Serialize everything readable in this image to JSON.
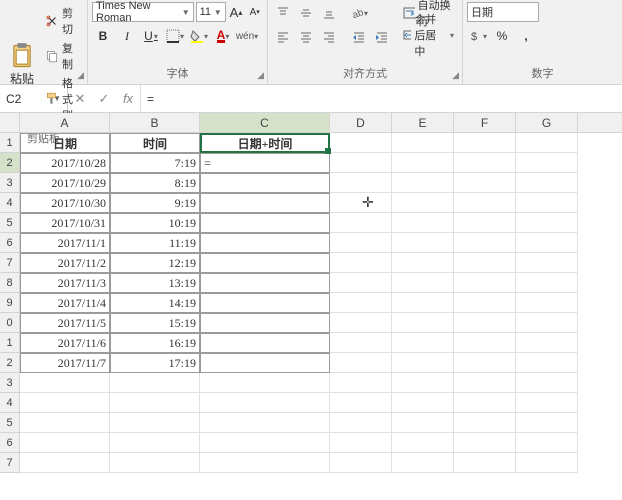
{
  "ribbon": {
    "clipboard": {
      "title": "剪贴板",
      "paste": "粘贴",
      "cut": "剪切",
      "copy": "复制",
      "format_painter": "格式刷"
    },
    "font": {
      "title": "字体",
      "name": "Times New Roman",
      "size": "11",
      "bold": "B",
      "italic": "I",
      "underline": "U"
    },
    "alignment": {
      "title": "对齐方式",
      "wrap": "自动换行",
      "merge": "合并后居中"
    },
    "number": {
      "title": "数字",
      "format": "日期",
      "percent": "%",
      "comma": ","
    }
  },
  "formula_bar": {
    "name_box": "C2",
    "formula": "="
  },
  "columns": [
    "A",
    "B",
    "C",
    "D",
    "E",
    "F",
    "G"
  ],
  "headers": {
    "A": "日期",
    "B": "时间",
    "C": "日期+时间"
  },
  "data_rows": [
    {
      "n": "2",
      "A": "2017/10/28",
      "B": "7:19",
      "C": "="
    },
    {
      "n": "3",
      "A": "2017/10/29",
      "B": "8:19",
      "C": ""
    },
    {
      "n": "4",
      "A": "2017/10/30",
      "B": "9:19",
      "C": ""
    },
    {
      "n": "5",
      "A": "2017/10/31",
      "B": "10:19",
      "C": ""
    },
    {
      "n": "6",
      "A": "2017/11/1",
      "B": "11:19",
      "C": ""
    },
    {
      "n": "7",
      "A": "2017/11/2",
      "B": "12:19",
      "C": ""
    },
    {
      "n": "8",
      "A": "2017/11/3",
      "B": "13:19",
      "C": ""
    },
    {
      "n": "9",
      "A": "2017/11/4",
      "B": "14:19",
      "C": ""
    },
    {
      "n": "0",
      "A": "2017/11/5",
      "B": "15:19",
      "C": ""
    },
    {
      "n": "1",
      "A": "2017/11/6",
      "B": "16:19",
      "C": ""
    },
    {
      "n": "2",
      "A": "2017/11/7",
      "B": "17:19",
      "C": ""
    }
  ],
  "empty_rows": [
    "3",
    "4",
    "5",
    "6",
    "7"
  ],
  "active_cell": {
    "row": 2,
    "col": "C"
  }
}
